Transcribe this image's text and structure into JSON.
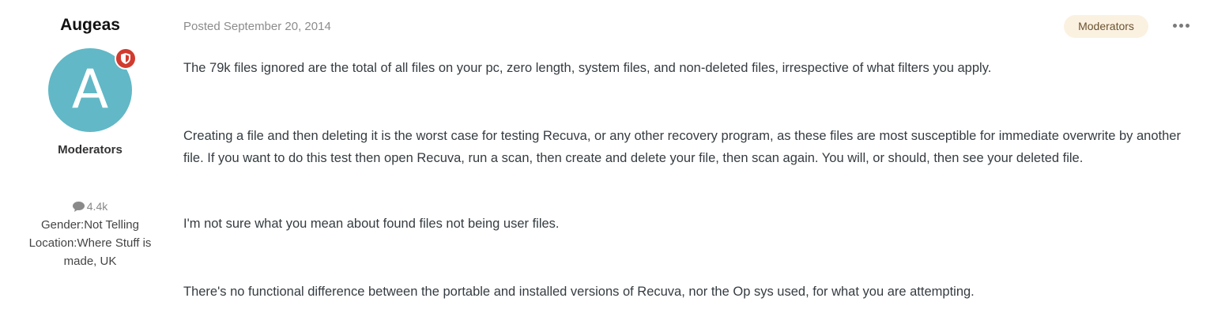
{
  "author": {
    "name": "Augeas",
    "avatar_letter": "A",
    "avatar_color": "#62b8c6",
    "badge_color": "#d13b2f",
    "badge_icon": "shield-icon",
    "group": "Moderators",
    "post_count": "4.4k",
    "post_count_icon": "comment-icon",
    "gender": "Gender:Not Telling",
    "location_line1": "Location:Where Stuff is",
    "location_line2": "made, UK"
  },
  "post": {
    "date": "Posted September 20, 2014",
    "group_pill": "Moderators",
    "more_icon": "ellipsis-icon",
    "paragraphs": [
      "The 79k files ignored are the total of all files on your pc, zero length, system files, and non-deleted files, irrespective of what filters you apply.",
      "Creating a file and then deleting it is the worst case for testing Recuva, or any other recovery program, as these files are most susceptible for immediate overwrite by another file. If you want to do this test then open Recuva, run a scan, then create and delete your file, then scan again. You will, or should, then see your deleted file.",
      "I'm not sure what you mean about found files not being user files.",
      "There's no functional difference between  the portable and installed versions of Recuva, nor the Op sys used, for what you are attempting."
    ]
  }
}
